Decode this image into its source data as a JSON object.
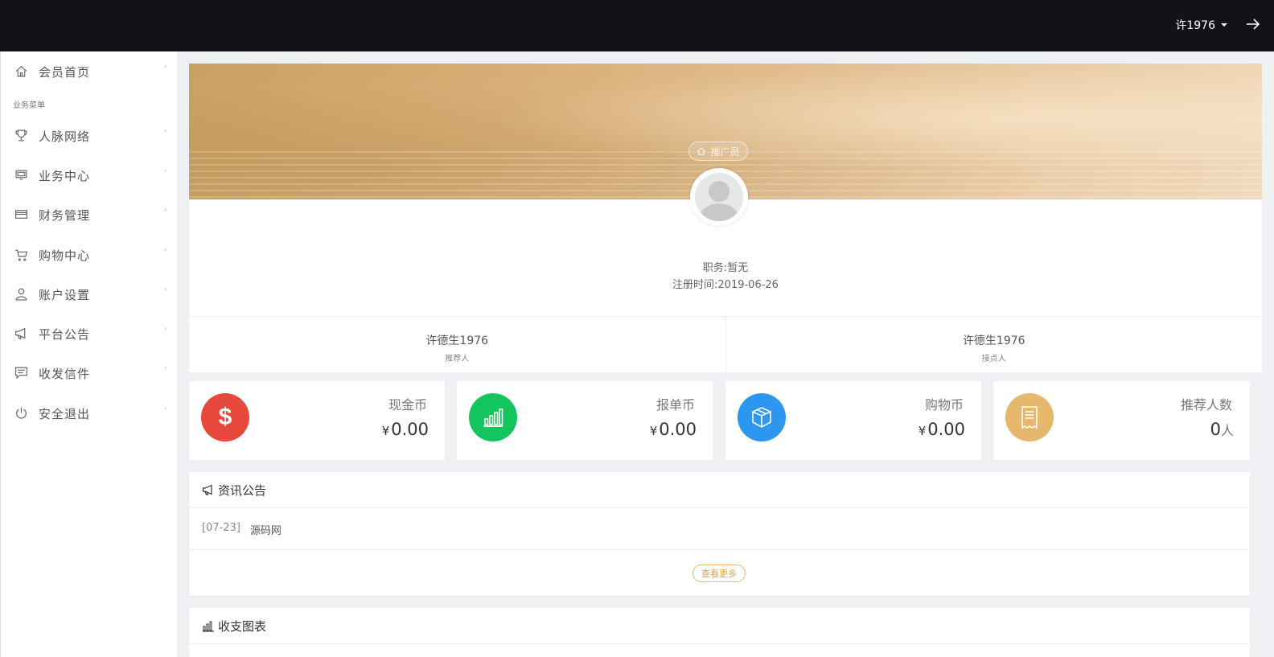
{
  "topbar": {
    "username": "许1976",
    "icons": {
      "caret": "chevron-down-icon",
      "logout": "arrow-right-icon"
    }
  },
  "sidebar": {
    "home": {
      "label": "会员首页",
      "icon": "home-icon"
    },
    "section_title": "业务菜单",
    "items": [
      {
        "label": "人脉网络",
        "icon": "trophy-icon"
      },
      {
        "label": "业务中心",
        "icon": "monitor-icon"
      },
      {
        "label": "财务管理",
        "icon": "card-icon"
      },
      {
        "label": "购物中心",
        "icon": "cart-icon"
      },
      {
        "label": "账户设置",
        "icon": "user-icon"
      },
      {
        "label": "平台公告",
        "icon": "megaphone-icon"
      },
      {
        "label": "收发信件",
        "icon": "message-icon"
      },
      {
        "label": "安全退出",
        "icon": "power-icon"
      }
    ]
  },
  "profile": {
    "role_badge": "推广员",
    "position_label": "职务:",
    "position_value": "暂无",
    "register_label": "注册时间:",
    "register_value": "2019-06-26",
    "referrer": {
      "name": "许德生1976",
      "role": "推荐人"
    },
    "placement": {
      "name": "许德生1976",
      "role": "接点人"
    }
  },
  "stats": [
    {
      "title": "现金币",
      "currency": "¥",
      "value": "0.00",
      "unit": "",
      "color": "#e8473b",
      "icon": "dollar-icon"
    },
    {
      "title": "报单币",
      "currency": "¥",
      "value": "0.00",
      "unit": "",
      "color": "#14c45c",
      "icon": "bar-chart-icon"
    },
    {
      "title": "购物币",
      "currency": "¥",
      "value": "0.00",
      "unit": "",
      "color": "#2d97f0",
      "icon": "box-icon"
    },
    {
      "title": "推荐人数",
      "currency": "",
      "value": "0",
      "unit": "人",
      "color": "#e5b86e",
      "icon": "receipt-icon"
    }
  ],
  "news": {
    "title": "资讯公告",
    "items": [
      {
        "date": "[07-23]",
        "title": "源码网"
      }
    ],
    "more_label": "查看更多"
  },
  "chart_panel": {
    "title": "收支图表"
  }
}
